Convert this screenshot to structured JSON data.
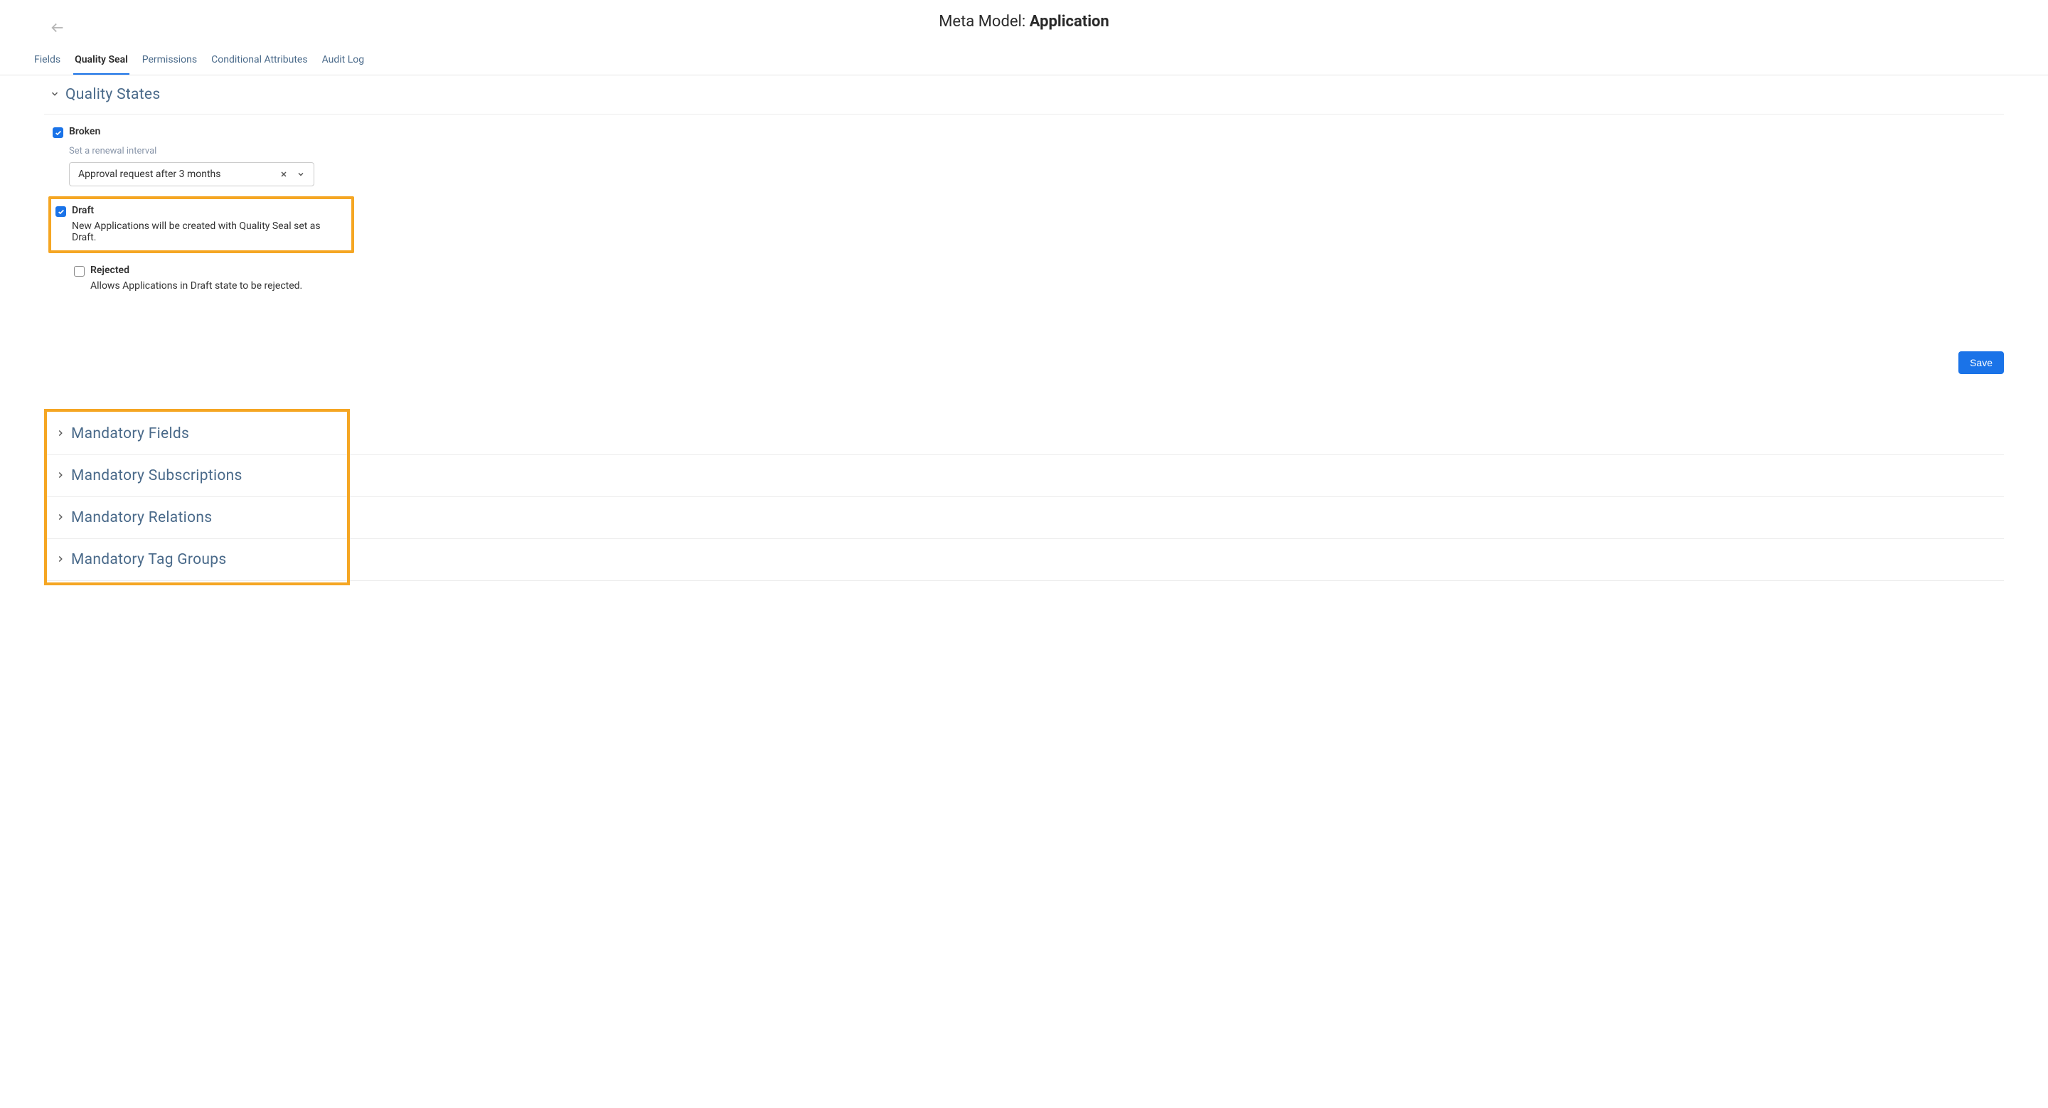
{
  "header": {
    "titlePrefix": "Meta Model: ",
    "titleBold": "Application"
  },
  "tabs": {
    "fields": "Fields",
    "qualitySeal": "Quality Seal",
    "permissions": "Permissions",
    "conditionalAttributes": "Conditional Attributes",
    "auditLog": "Audit Log"
  },
  "qualityStates": {
    "title": "Quality States",
    "broken": {
      "label": "Broken",
      "sublabel": "Set a renewal interval",
      "selectValue": "Approval request after 3 months"
    },
    "draft": {
      "label": "Draft",
      "description": "New Applications will be created with Quality Seal set as Draft."
    },
    "rejected": {
      "label": "Rejected",
      "description": "Allows Applications in Draft state to be rejected."
    }
  },
  "buttons": {
    "save": "Save"
  },
  "accordion": {
    "mandatoryFields": "Mandatory Fields",
    "mandatorySubscriptions": "Mandatory Subscriptions",
    "mandatoryRelations": "Mandatory Relations",
    "mandatoryTagGroups": "Mandatory Tag Groups"
  }
}
